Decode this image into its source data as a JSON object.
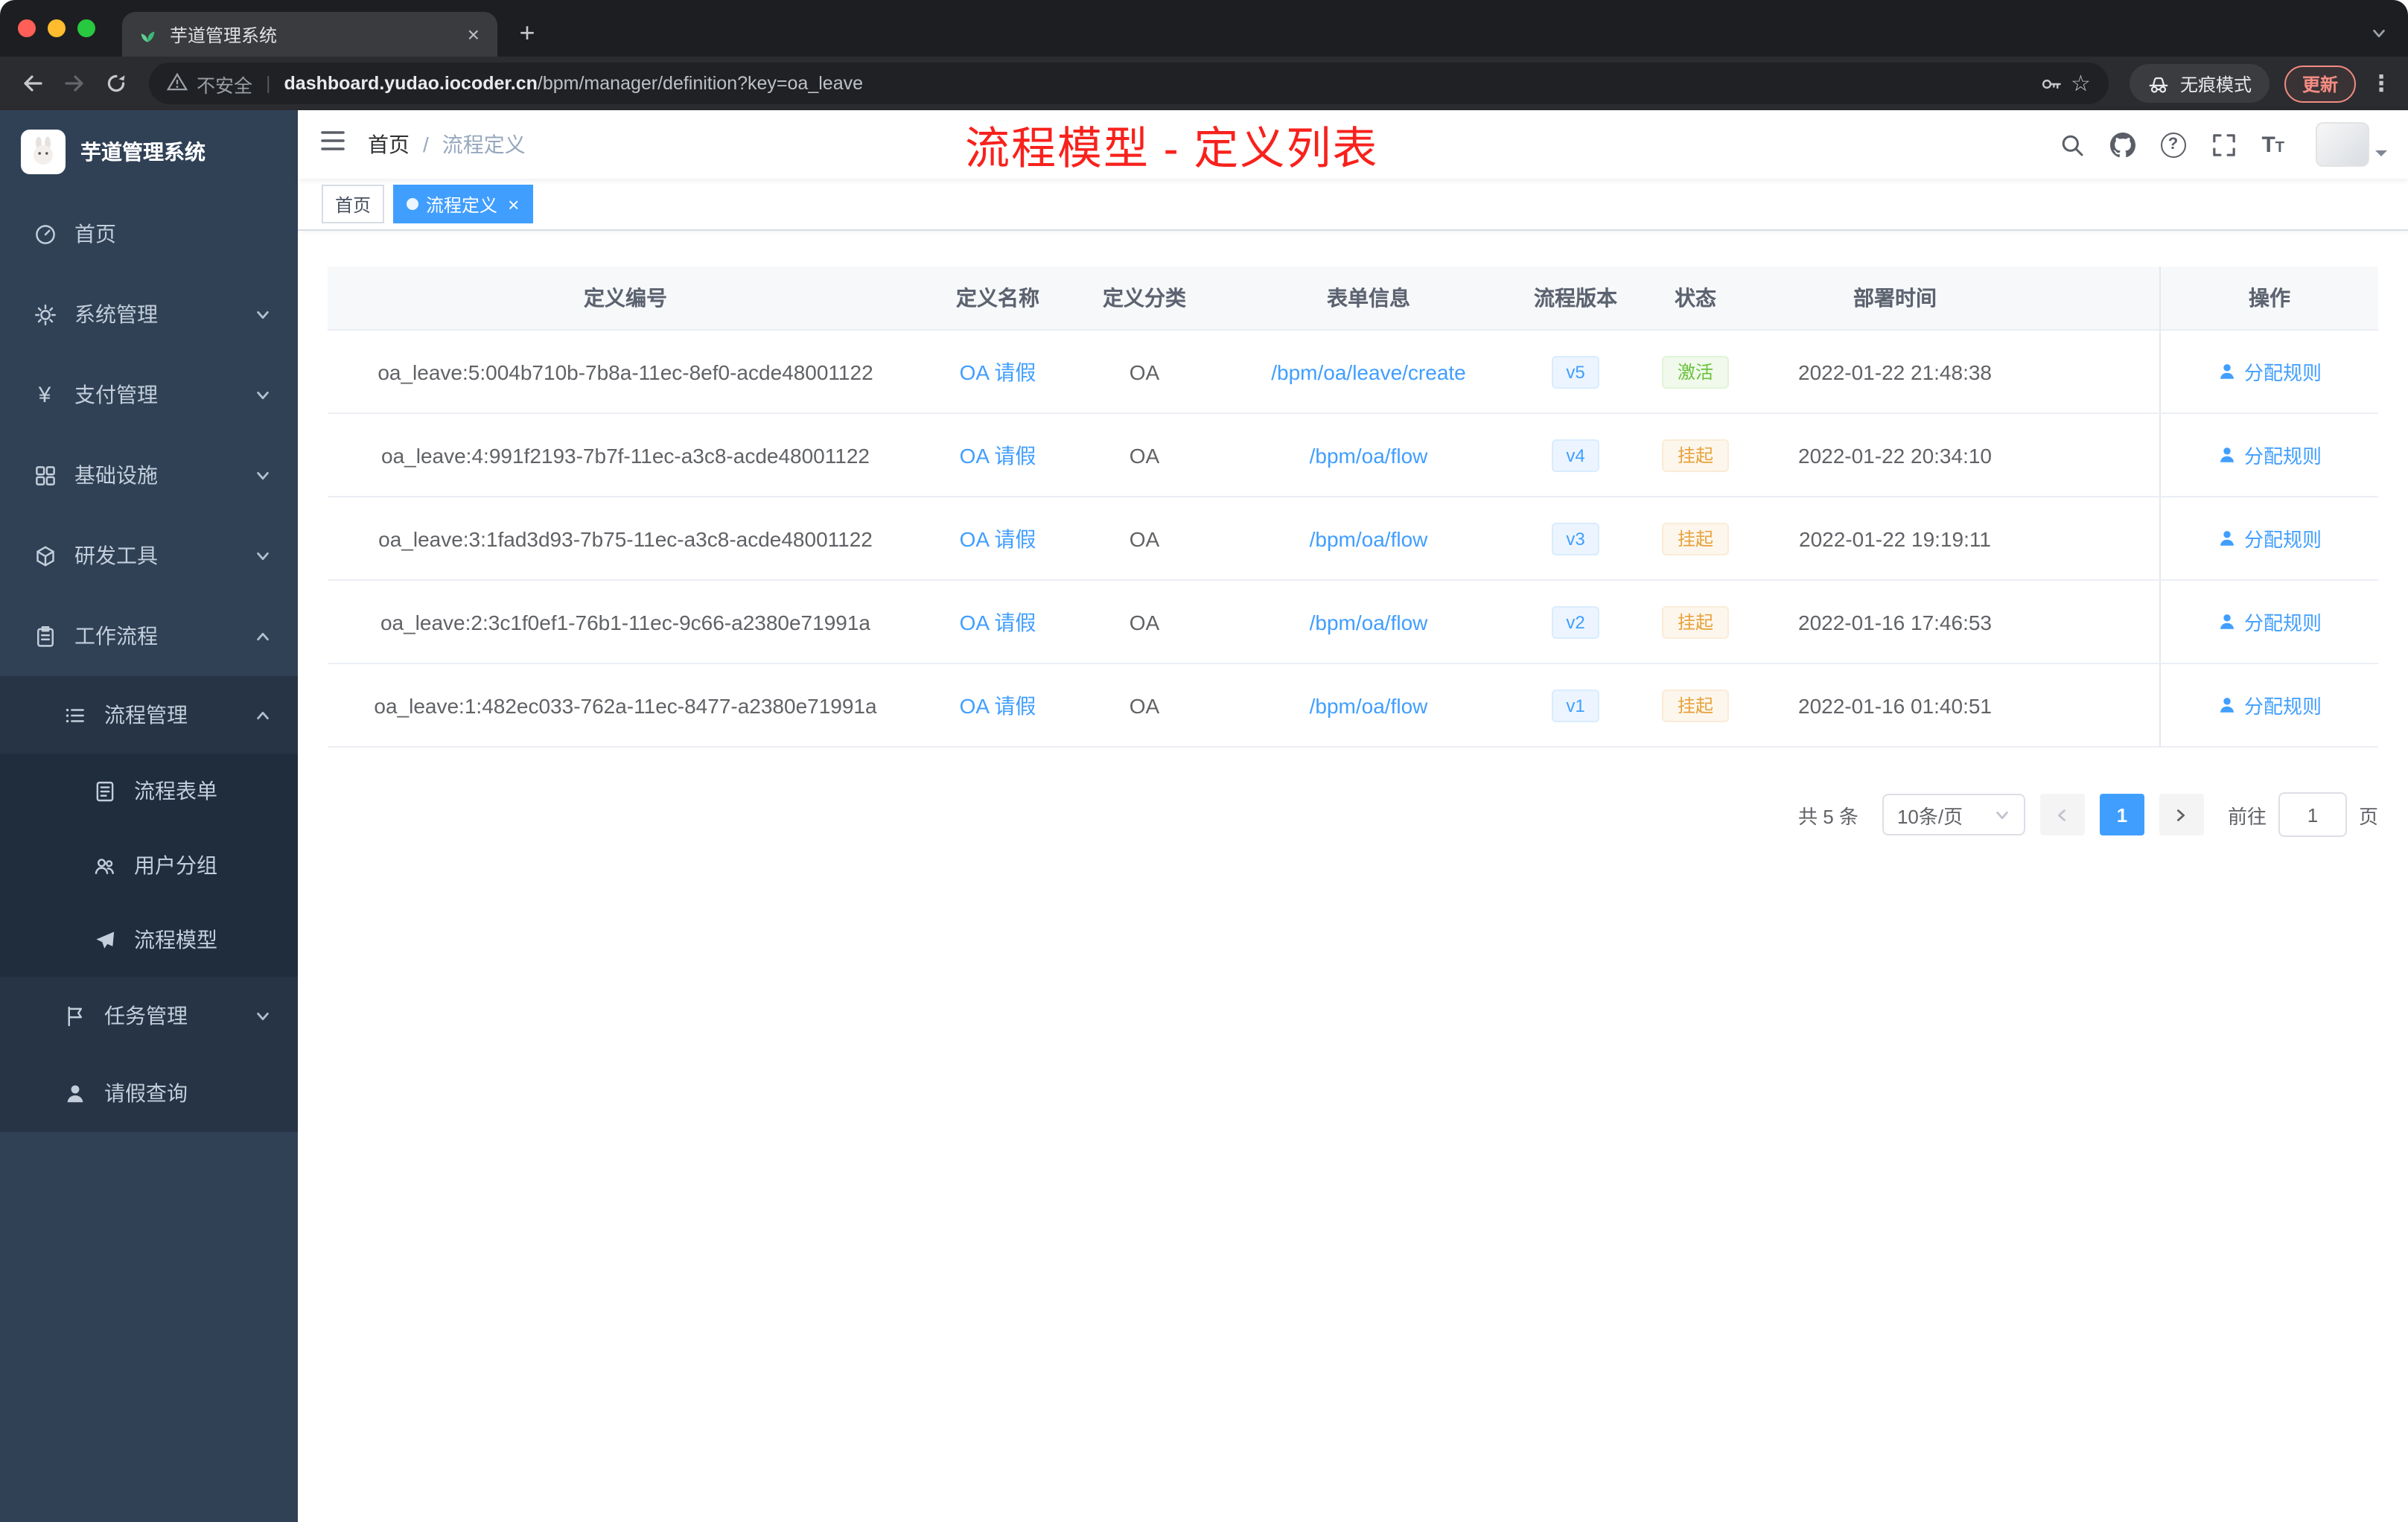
{
  "browser": {
    "tab_title": "芋道管理系统",
    "security_label": "不安全",
    "url_domain": "dashboard.yudao.iocoder.cn",
    "url_path": "/bpm/manager/definition?key=oa_leave",
    "incognito_label": "无痕模式",
    "update_label": "更新"
  },
  "icons": {
    "close": "×",
    "new_tab": "+",
    "more": "⋮",
    "star": "☆",
    "question": "?",
    "yen": "¥",
    "slash": "/",
    "divider": "|",
    "font_large": "T",
    "font_small": "T"
  },
  "sidebar": {
    "title": "芋道管理系统",
    "menu": {
      "home": "首页",
      "system": "系统管理",
      "payment": "支付管理",
      "infra": "基础设施",
      "devtools": "研发工具",
      "workflow": "工作流程",
      "process_mgmt": "流程管理",
      "process_form": "流程表单",
      "user_group": "用户分组",
      "process_model": "流程模型",
      "task_mgmt": "任务管理",
      "leave_query": "请假查询"
    }
  },
  "header": {
    "breadcrumb_home": "首页",
    "breadcrumb_current": "流程定义",
    "annotation": "流程模型 - 定义列表"
  },
  "tags": {
    "home": "首页",
    "current": "流程定义"
  },
  "table": {
    "columns": [
      "定义编号",
      "定义名称",
      "定义分类",
      "表单信息",
      "流程版本",
      "状态",
      "部署时间",
      "操作"
    ],
    "rows": [
      {
        "id": "oa_leave:5:004b710b-7b8a-11ec-8ef0-acde48001122",
        "name": "OA 请假",
        "category": "OA",
        "form": "/bpm/oa/leave/create",
        "version": "v5",
        "status": "激活",
        "status_type": "active",
        "deployed_at": "2022-01-22 21:48:38",
        "action": "分配规则"
      },
      {
        "id": "oa_leave:4:991f2193-7b7f-11ec-a3c8-acde48001122",
        "name": "OA 请假",
        "category": "OA",
        "form": "/bpm/oa/flow",
        "version": "v4",
        "status": "挂起",
        "status_type": "suspended",
        "deployed_at": "2022-01-22 20:34:10",
        "action": "分配规则"
      },
      {
        "id": "oa_leave:3:1fad3d93-7b75-11ec-a3c8-acde48001122",
        "name": "OA 请假",
        "category": "OA",
        "form": "/bpm/oa/flow",
        "version": "v3",
        "status": "挂起",
        "status_type": "suspended",
        "deployed_at": "2022-01-22 19:19:11",
        "action": "分配规则"
      },
      {
        "id": "oa_leave:2:3c1f0ef1-76b1-11ec-9c66-a2380e71991a",
        "name": "OA 请假",
        "category": "OA",
        "form": "/bpm/oa/flow",
        "version": "v2",
        "status": "挂起",
        "status_type": "suspended",
        "deployed_at": "2022-01-16 17:46:53",
        "action": "分配规则"
      },
      {
        "id": "oa_leave:1:482ec033-762a-11ec-8477-a2380e71991a",
        "name": "OA 请假",
        "category": "OA",
        "form": "/bpm/oa/flow",
        "version": "v1",
        "status": "挂起",
        "status_type": "suspended",
        "deployed_at": "2022-01-16 01:40:51",
        "action": "分配规则"
      }
    ]
  },
  "pagination": {
    "total": "共 5 条",
    "page_size": "10条/页",
    "page": "1",
    "goto_label": "前往",
    "goto_value": "1",
    "unit": "页"
  },
  "colors": {
    "accent": "#409eff",
    "success": "#67c23a",
    "warning": "#e6a23c",
    "sidebar_bg": "#304156",
    "annotation_red": "#f8211c"
  }
}
